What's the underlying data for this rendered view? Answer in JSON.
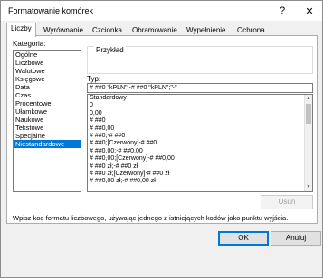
{
  "window": {
    "title": "Formatowanie komórek",
    "help_label": "?",
    "close_label": "✕"
  },
  "tabs": [
    {
      "label": "Liczby",
      "active": true
    },
    {
      "label": "Wyrównanie",
      "active": false
    },
    {
      "label": "Czcionka",
      "active": false
    },
    {
      "label": "Obramowanie",
      "active": false
    },
    {
      "label": "Wypełnienie",
      "active": false
    },
    {
      "label": "Ochrona",
      "active": false
    }
  ],
  "category": {
    "label": "Kategoria:",
    "items": [
      "Ogólne",
      "Liczbowe",
      "Walutowe",
      "Księgowe",
      "Data",
      "Czas",
      "Procentowe",
      "Ułamkowe",
      "Naukowe",
      "Tekstowe",
      "Specjalne",
      "Niestandardowe"
    ],
    "selected": "Niestandardowe"
  },
  "preview": {
    "label": "Przykład",
    "value": ""
  },
  "type": {
    "label": "Typ:",
    "value": "# ##0 \"kPLN\";-# ##0 \"kPLN\";\"-\""
  },
  "formats": [
    "Standardowy",
    "0",
    "0,00",
    "# ##0",
    "# ##0,00",
    "# ##0;-# ##0",
    "# ##0;[Czerwony]-# ##0",
    "# ##0,00;-# ##0,00",
    "# ##0,00;[Czerwony]-# ##0,00",
    "# ##0 zł;-# ##0 zł",
    "# ##0 zł;[Czerwony]-# ##0 zł",
    "# ##0,00 zł;-# ##0,00 zł"
  ],
  "delete_button": "Usuń",
  "hint": "Wpisz kod formatu liczbowego, używając jednego z istniejących kodów jako punktu wyjścia.",
  "ok_button": "OK",
  "cancel_button": "Anuluj",
  "colors": {
    "selection": "#0078d7",
    "dialog_bg": "#f0f0f0"
  }
}
